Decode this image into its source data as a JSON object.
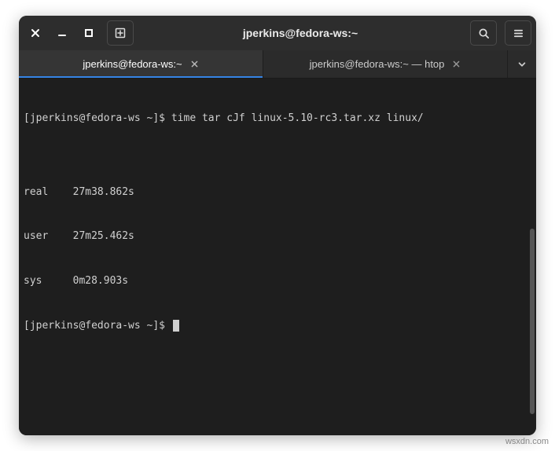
{
  "window": {
    "title": "jperkins@fedora-ws:~"
  },
  "tabs": [
    {
      "label": "jperkins@fedora-ws:~",
      "active": true
    },
    {
      "label": "jperkins@fedora-ws:~ — htop",
      "active": false
    }
  ],
  "terminal": {
    "prompt1": "[jperkins@fedora-ws ~]$ ",
    "command1": "time tar cJf linux-5.10-rc3.tar.xz linux/",
    "blank": "",
    "time_real": "real    27m38.862s",
    "time_user": "user    27m25.462s",
    "time_sys": "sys     0m28.903s",
    "prompt2": "[jperkins@fedora-ws ~]$ "
  },
  "watermark": "wsxdn.com"
}
